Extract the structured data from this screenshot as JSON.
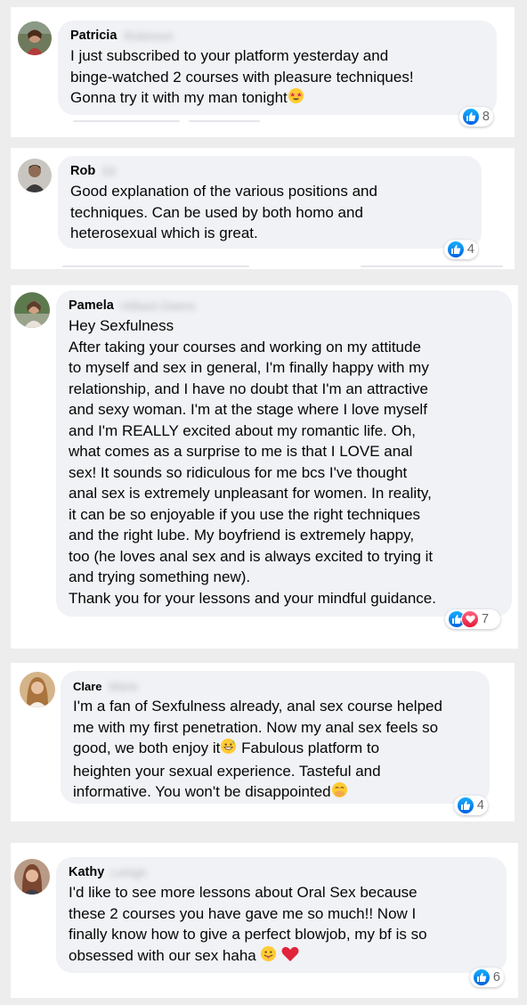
{
  "comments": [
    {
      "author": "Patricia",
      "surname": "Robinson",
      "text": "I just subscribed to your platform yesterday and\nbinge-watched 2 courses with pleasure techniques!\nGonna try it with my man tonight",
      "emoji": "star-struck-emoji",
      "reactions": [
        "like"
      ],
      "count": "8"
    },
    {
      "author": "Rob",
      "surname": "Ell",
      "text": "Good explanation of the various positions and\ntechniques. Can be used by both homo and\nheterosexual which is great.",
      "reactions": [
        "like"
      ],
      "count": "4"
    },
    {
      "author": "Pamela",
      "surname": "Hilliard Owens",
      "text": "Hey Sexfulness\nAfter taking your courses and working on my attitude\nto myself and sex in general, I'm finally happy with my\nrelationship, and I have no doubt that I'm an attractive\nand sexy woman. I'm at the stage where I love myself\nand I'm REALLY excited about my romantic life. Oh,\nwhat comes as a surprise to me is that I LOVE anal\nsex! It sounds so ridiculous for me bcs I've thought\nanal sex is extremely unpleasant for women. In reality,\nit can be so enjoyable if you use the right techniques\nand the right lube. My boyfriend is extremely happy,\ntoo (he loves anal sex and is always excited to trying it\nand trying something new).\nThank you for your lessons and your mindful guidance.",
      "reactions": [
        "like",
        "love"
      ],
      "count": "7"
    },
    {
      "author": "Clare",
      "surname": "Marie",
      "text_a": "I'm a fan of Sexfulness already, anal sex course helped\nme with my first penetration. Now my anal sex feels so\ngood, we both enjoy it",
      "text_b": " Fabulous platform to\nheighten your sexual experience. Tasteful and\ninformative. You won't be disappointed",
      "emoji_a": "grinning-sweat-emoji",
      "emoji_b": "hand-over-mouth-emoji",
      "reactions": [
        "like"
      ],
      "count": "4"
    },
    {
      "author": "Kathy",
      "surname": "Lehigh",
      "text": "I'd like to see more lessons about Oral Sex because\nthese 2 courses you have gave me so much!! Now I\nfinally know how to give a perfect blowjob, my bf is so\nobsessed with our sex haha ",
      "emoji_a": "tongue-out-emoji",
      "emoji_b": "red-heart-emoji",
      "reactions": [
        "like"
      ],
      "count": "6"
    }
  ],
  "colors": {
    "bubble": "#f0f2f5",
    "like": "#1877f2",
    "love": "#f33e58",
    "page_bg": "#ededed"
  }
}
